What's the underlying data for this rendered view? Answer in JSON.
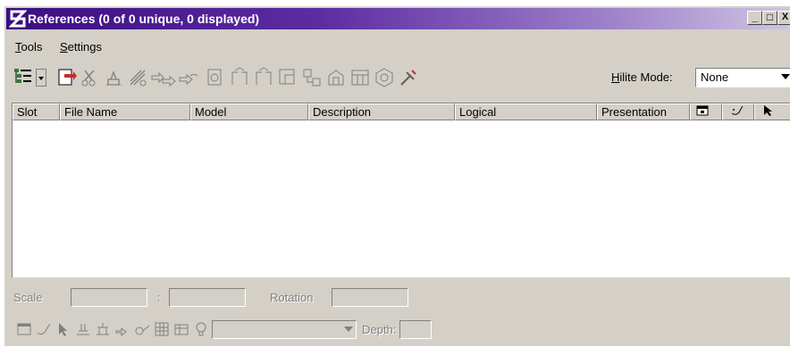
{
  "window": {
    "title": "References (0 of 0 unique, 0 displayed)"
  },
  "title_buttons": {
    "minimize": "_",
    "maximize": "□",
    "close": "X"
  },
  "menu": {
    "tools": {
      "underline": "T",
      "rest": "ools"
    },
    "settings": {
      "underline": "S",
      "rest": "ettings"
    }
  },
  "toolbar": {
    "tools": [
      "tree-view-icon",
      "dropdown-arrow-icon",
      "attach-reference-icon",
      "detach-icon",
      "move-icon",
      "scale-icon",
      "copy-icon",
      "rotate-icon",
      "reload-icon",
      "mirror-horizontal-icon",
      "mirror-vertical-icon",
      "clip-boundary-icon",
      "clip-mask-icon",
      "delete-clip-icon",
      "clip-front-icon",
      "clip-back-icon",
      "settings-icon",
      "hilite-tool-icon"
    ],
    "hilite_label_underline": "H",
    "hilite_label_rest": "ilite Mode:",
    "hilite_value": "None"
  },
  "table": {
    "columns": [
      "Slot",
      "File Name",
      "Model",
      "Description",
      "Logical",
      "Presentation"
    ],
    "icon_columns": [
      "display-icon",
      "snap-icon",
      "locate-icon"
    ],
    "rows": []
  },
  "bottom": {
    "scale_label": "Scale",
    "scale_separator": ":",
    "rotation_label": "Rotation",
    "depth_label": "Depth:",
    "scale_value_1": "",
    "scale_value_2": "",
    "rotation_value": "",
    "depth_value": "",
    "icons": [
      "display-icon",
      "snap-icon",
      "locate-icon",
      "ignore-attachment-icon",
      "nested-icon",
      "treat-as-element-icon",
      "scale-line-style-icon",
      "levels-icon",
      "raster-icon",
      "light-icon"
    ]
  }
}
